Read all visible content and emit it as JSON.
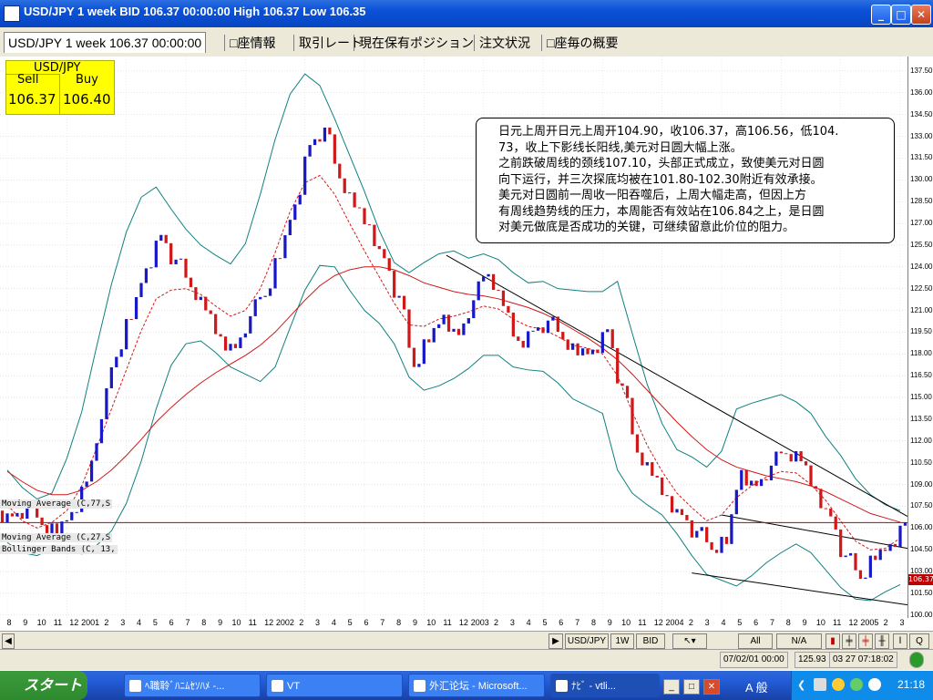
{
  "window": {
    "title": "USD/JPY 1 week BID 106.37 00:00:00 High 106.37 Low 106.35",
    "buttons": [
      "_",
      "□",
      "✕"
    ]
  },
  "tabs": [
    {
      "label": "USD/JPY 1 week 106.37 00:00:00",
      "active": true
    },
    {
      "label": "□座情報",
      "active": false
    },
    {
      "label": "取引レート",
      "active": false
    },
    {
      "label": "現在保有ポジション",
      "active": false
    },
    {
      "label": "注文状況",
      "active": false
    },
    {
      "label": "□座毎の概要",
      "active": false
    }
  ],
  "quote": {
    "pair": "USD/JPY",
    "sell_label": "Sell",
    "buy_label": "Buy",
    "sell": "106.37",
    "buy": "106.40"
  },
  "note_lines": [
    "日元上周开日元上周开104.90，收106.37，高106.56，低104.",
    "73，收上下影线长阳线,美元对日圆大幅上涨。",
    "之前跌破周线的颈线107.10，头部正式成立，致使美元对日圆",
    "向下运行，并三次探底均被在101.80-102.30附近有效承接。",
    "美元对日圆前一周收一阳吞噬后，上周大幅走高，但因上方",
    "有周线趋势线的压力，本周能否有效站在106.84之上，是日圆",
    "对美元做底是否成功的关键，可继续留意此价位的阻力。"
  ],
  "indicators": [
    "Moving Average (C,77,S",
    "Moving Average (C,27,S",
    "Bollinger Bands (C, 13,"
  ],
  "chart_data": {
    "type": "line",
    "subtype": "candlestick-with-overlays",
    "symbol": "USD/JPY",
    "timeframe": "1 week",
    "y_ticks": [
      "137.50",
      "136.00",
      "134.50",
      "133.00",
      "131.50",
      "130.00",
      "128.50",
      "127.00",
      "125.50",
      "124.00",
      "122.50",
      "121.00",
      "119.50",
      "118.00",
      "116.50",
      "115.00",
      "113.50",
      "112.00",
      "110.50",
      "109.00",
      "107.50",
      "106.00",
      "104.50",
      "103.00",
      "101.50",
      "100.00"
    ],
    "ylim": [
      99.8,
      138.5
    ],
    "x_ticks": [
      "8",
      "9",
      "10",
      "11",
      "12",
      "2001",
      "2",
      "3",
      "4",
      "5",
      "6",
      "7",
      "8",
      "9",
      "10",
      "11",
      "12",
      "2002",
      "2",
      "3",
      "4",
      "5",
      "6",
      "7",
      "8",
      "9",
      "10",
      "11",
      "12",
      "2003",
      "2",
      "3",
      "4",
      "5",
      "6",
      "7",
      "8",
      "9",
      "10",
      "11",
      "12",
      "2004",
      "2",
      "3",
      "4",
      "5",
      "6",
      "7",
      "8",
      "9",
      "10",
      "11",
      "12",
      "2005",
      "2",
      "3"
    ],
    "last_price": "106.37",
    "colors": {
      "up": "#1818c8",
      "down": "#d01818",
      "ma_fast": "#d01818",
      "ma_slow": "#d01818",
      "bollinger": "#108080",
      "trendline": "#000000",
      "price_line": "#c00000"
    },
    "series": [
      {
        "type": "close",
        "values": [
          106.8,
          107.5,
          106.2,
          105.6,
          107.1,
          109.2,
          113.5,
          117.8,
          120.4,
          123.9,
          126.2,
          124.5,
          122.6,
          121.0,
          119.2,
          118.4,
          120.6,
          122.0,
          124.6,
          128.3,
          132.4,
          133.6,
          130.1,
          128.1,
          126.9,
          124.6,
          122.0,
          117.1,
          118.8,
          120.7,
          119.3,
          121.7,
          123.5,
          121.3,
          118.9,
          119.6,
          120.3,
          119.0,
          117.9,
          118.3,
          119.7,
          115.8,
          111.2,
          109.6,
          108.2,
          106.9,
          105.8,
          104.5,
          104.9,
          110.0,
          108.9,
          110.3,
          111.1,
          110.6,
          108.7,
          106.8,
          104.1,
          102.5,
          103.8,
          104.9,
          106.37
        ]
      },
      {
        "type": "ma_fast",
        "values": [
          107.6,
          106.5,
          106.0,
          106.4,
          107.2,
          108.9,
          111.5,
          114.2,
          116.9,
          119.6,
          121.8,
          122.4,
          122.5,
          122.1,
          121.3,
          120.6,
          121.0,
          122.5,
          125.0,
          127.8,
          129.8,
          130.3,
          129.0,
          127.0,
          125.1,
          123.3,
          121.5,
          120.0,
          119.9,
          120.4,
          120.6,
          120.9,
          121.3,
          121.1,
          120.4,
          119.9,
          119.7,
          119.2,
          118.6,
          118.4,
          118.0,
          116.5,
          114.0,
          111.7,
          109.9,
          108.4,
          107.4,
          106.5,
          106.9,
          108.1,
          108.9,
          109.5,
          109.9,
          109.8,
          109.0,
          107.9,
          106.5,
          105.1,
          104.5,
          104.6,
          105.3
        ]
      },
      {
        "type": "ma_slow",
        "values": [
          109.9,
          109.2,
          108.6,
          108.3,
          108.3,
          108.6,
          109.2,
          110.0,
          111.0,
          112.1,
          113.3,
          114.3,
          115.2,
          116.0,
          116.7,
          117.3,
          117.9,
          118.6,
          119.5,
          120.6,
          121.7,
          122.7,
          123.4,
          123.8,
          124.0,
          124.0,
          123.8,
          123.4,
          122.9,
          122.6,
          122.3,
          122.1,
          122.0,
          121.8,
          121.5,
          121.2,
          120.8,
          120.3,
          119.7,
          119.1,
          118.4,
          117.6,
          116.6,
          115.5,
          114.4,
          113.3,
          112.3,
          111.4,
          110.7,
          110.2,
          109.9,
          109.6,
          109.4,
          109.2,
          108.9,
          108.5,
          108.0,
          107.5,
          107.0,
          106.7,
          106.4
        ]
      },
      {
        "type": "bollinger_upper",
        "values": [
          110.0,
          108.8,
          108.0,
          108.4,
          110.8,
          114.0,
          118.5,
          122.8,
          126.4,
          128.8,
          129.5,
          128.0,
          126.6,
          125.5,
          124.8,
          124.2,
          125.6,
          129.0,
          132.8,
          135.9,
          137.3,
          136.5,
          134.2,
          131.7,
          129.2,
          126.5,
          124.3,
          123.6,
          124.3,
          124.9,
          125.1,
          124.6,
          124.9,
          124.5,
          123.6,
          122.9,
          123.0,
          122.5,
          122.4,
          122.3,
          122.3,
          123.0,
          119.4,
          115.9,
          113.2,
          111.4,
          110.9,
          110.2,
          111.3,
          114.2,
          114.6,
          114.9,
          115.2,
          114.7,
          113.9,
          112.3,
          111.0,
          109.4,
          108.3,
          107.6,
          107.2
        ]
      },
      {
        "type": "bollinger_lower",
        "values": [
          105.0,
          104.3,
          104.1,
          104.6,
          104.8,
          104.2,
          104.8,
          105.8,
          107.7,
          110.6,
          114.2,
          117.2,
          118.7,
          118.9,
          118.1,
          117.1,
          116.6,
          116.1,
          117.1,
          119.8,
          122.4,
          124.1,
          124.0,
          122.4,
          121.0,
          120.1,
          118.7,
          116.4,
          115.5,
          115.8,
          116.3,
          117.0,
          117.9,
          117.9,
          117.1,
          116.9,
          116.8,
          116.0,
          114.9,
          114.4,
          113.9,
          110.0,
          108.4,
          107.6,
          106.9,
          105.6,
          104.1,
          102.8,
          102.4,
          102.0,
          102.7,
          103.6,
          104.3,
          104.9,
          104.3,
          103.1,
          101.9,
          101.1,
          101.0,
          101.6,
          102.1
        ]
      }
    ]
  },
  "x_axis_labels": [
    "8",
    "9",
    "10",
    "11",
    "12",
    "2001",
    "2",
    "3",
    "4",
    "5",
    "6",
    "7",
    "8",
    "9",
    "10",
    "11",
    "12",
    "2002",
    "2",
    "3",
    "4",
    "5",
    "6",
    "7",
    "8",
    "9",
    "10",
    "11",
    "12",
    "2003",
    "2",
    "3",
    "4",
    "5",
    "6",
    "7",
    "8",
    "9",
    "10",
    "11",
    "12",
    "2004",
    "2",
    "3",
    "4",
    "5",
    "6",
    "7",
    "8",
    "9",
    "10",
    "11",
    "12",
    "2005",
    "2",
    "3"
  ],
  "toolbar": {
    "pair": "USD/JPY",
    "tf": "1W",
    "side": "BID",
    "all": "All",
    "na": "N/A"
  },
  "status": {
    "date": "07/02/01 00:00",
    "value": "125.93",
    "time": "03 27 07:18:02"
  },
  "taskbar": {
    "start": "スタート",
    "tasks": [
      "ﾍ職聆ﾞﾊﾆﾑｾｿﾊﾒ -...",
      "VT",
      "外汇论坛 - Microsoft...",
      "ﾅﾋﾞ - vtli..."
    ],
    "ime": "A 般",
    "clock": "21:18"
  }
}
